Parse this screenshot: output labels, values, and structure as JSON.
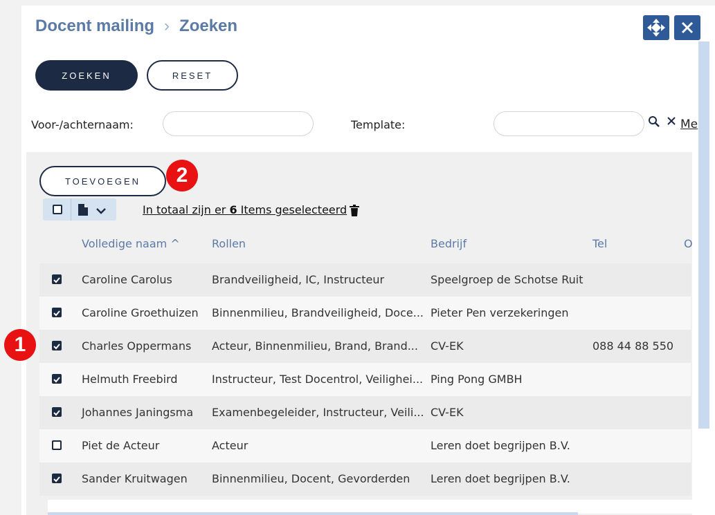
{
  "breadcrumb": {
    "parent": "Docent mailing",
    "separator": "›",
    "current": "Zoeken"
  },
  "toolbar": {
    "search_label": "ZOEKEN",
    "reset_label": "RESET"
  },
  "filters": {
    "name_label": "Voor-/achternaam:",
    "name_value": "",
    "template_label": "Template:",
    "template_value": "",
    "more_label": "Me"
  },
  "add_label": "TOEVOEGEN",
  "badges": {
    "one": "1",
    "two": "2"
  },
  "selection": {
    "prefix": "In totaal zijn er ",
    "count": "6",
    "suffix": " Items geselecteerd"
  },
  "columns": {
    "name": "Volledige naam ^",
    "roles": "Rollen",
    "company": "Bedrijf",
    "tel": "Tel",
    "other": "O"
  },
  "rows": [
    {
      "checked": true,
      "name": "Caroline Carolus",
      "roles": "Brandveiligheid, IC, Instructeur",
      "company": "Speelgroep de Schotse Ruit",
      "tel": ""
    },
    {
      "checked": true,
      "name": "Caroline Groethuizen",
      "roles": "Binnenmilieu, Brandveiligheid, Doce...",
      "company": "Pieter Pen verzekeringen",
      "tel": ""
    },
    {
      "checked": true,
      "name": "Charles Oppermans",
      "roles": "Acteur, Binnenmilieu, Brand, Brand...",
      "company": "CV-EK",
      "tel": "088 44 88 550"
    },
    {
      "checked": true,
      "name": "Helmuth Freebird",
      "roles": "Instructeur, Test Docentrol, Veilighei...",
      "company": "Ping Pong GMBH",
      "tel": ""
    },
    {
      "checked": true,
      "name": "Johannes Janingsma",
      "roles": "Examenbegeleider, Instructeur, Veili...",
      "company": "CV-EK",
      "tel": ""
    },
    {
      "checked": false,
      "name": "Piet de Acteur",
      "roles": "Acteur",
      "company": "Leren doet begrijpen B.V.",
      "tel": ""
    },
    {
      "checked": true,
      "name": "Sander Kruitwagen",
      "roles": "Binnenmilieu, Docent, Gevorderden",
      "company": "Leren doet begrijpen B.V.",
      "tel": ""
    }
  ],
  "icons": {
    "move": "move-icon",
    "close": "close-icon",
    "search": "search-icon",
    "clear": "clear-icon",
    "document": "document-icon",
    "chevron": "chevron-down-icon",
    "trash": "trash-icon"
  },
  "colors": {
    "accent": "#2e5a98",
    "dark": "#1c2a44",
    "title": "#5b7aa6",
    "badge": "#e81212"
  }
}
